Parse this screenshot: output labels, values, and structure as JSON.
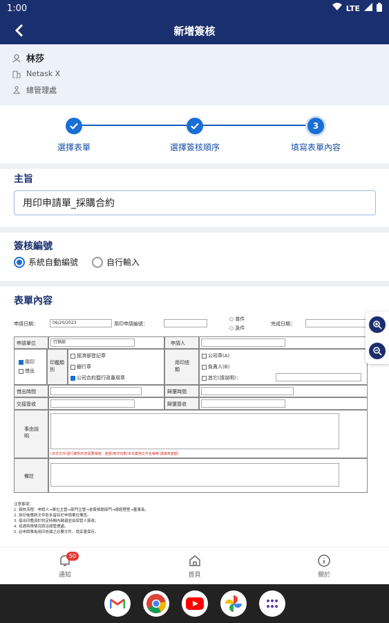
{
  "status": {
    "time": "1:00",
    "network": "LTE"
  },
  "appbar": {
    "title": "新增簽核"
  },
  "user": {
    "name": "林莎",
    "company": "Netask X",
    "department": "總管理處"
  },
  "steps": [
    {
      "label": "選擇表單",
      "state": "done"
    },
    {
      "label": "選擇簽核順序",
      "state": "done"
    },
    {
      "label": "填寫表單內容",
      "state": "current",
      "number": "3"
    }
  ],
  "subject": {
    "heading": "主旨",
    "value": "用印申請單_採購合約"
  },
  "numbering": {
    "heading": "簽核編號",
    "options": [
      "系統自動編號",
      "自行輸入"
    ],
    "selected": "系統自動編號"
  },
  "formcontent": {
    "heading": "表單內容"
  },
  "form": {
    "apply_date_label": "申請日期：",
    "apply_date_value": "06/20/2023",
    "form_no_label": "用印申請編號：",
    "priority_options": [
      "普件",
      "急件"
    ],
    "finish_date_label": "完成日期：",
    "unit_label": "申請單位",
    "unit_value": "行銷部",
    "applicant_label": "申請人",
    "action_options": [
      "用印",
      "借出"
    ],
    "action_checked": "用印",
    "seal_type_label": "印鑑類別",
    "seal_types": [
      "經濟部登記章",
      "銀行章",
      "公司合約暨行政專用章"
    ],
    "seal_type_checked": "公司合約暨行政專用章",
    "seal_kind_label": "用印總類",
    "seal_kinds": [
      "公司章(A)",
      "負責人(B)",
      "其它(請說明)："
    ],
    "borrow_time_label": "借出時間",
    "return_time_label": "歸還時間",
    "handover_label": "交接簽收",
    "return_sign_label": "歸還簽收",
    "reason_label": "事由說明",
    "reason_hint": "(本份文件/發行範例內容需要填寫：金額/用印份數/本份業務文件名稱等 請填寫金額)",
    "remark_label": "備註",
    "notes": [
      "注意事項：",
      "1. 簽核流程：申請人→單位主管→部門主管→會簽相關部門→總經理室→董事長。",
      "2. 用印後應將文件影本留存於申請單位備查。",
      "3. 借出印鑑須於約定時間內歸還並由保管人簽收。",
      "4. 如遇特殊情況請洽總管理處。",
      "5. 此申請單為用印依據之必要文件，請妥善保存。"
    ]
  },
  "bottomnav": [
    {
      "label": "通知",
      "icon": "bell-icon",
      "badge": "50"
    },
    {
      "label": "首頁",
      "icon": "home-icon"
    },
    {
      "label": "關於",
      "icon": "info-icon"
    }
  ],
  "dock": [
    "gmail-icon",
    "chrome-icon",
    "youtube-icon",
    "photos-icon",
    "apps-icon"
  ],
  "colors": {
    "primary": "#1a2f6e",
    "accent": "#1a6fd6",
    "badge": "#e53935"
  }
}
